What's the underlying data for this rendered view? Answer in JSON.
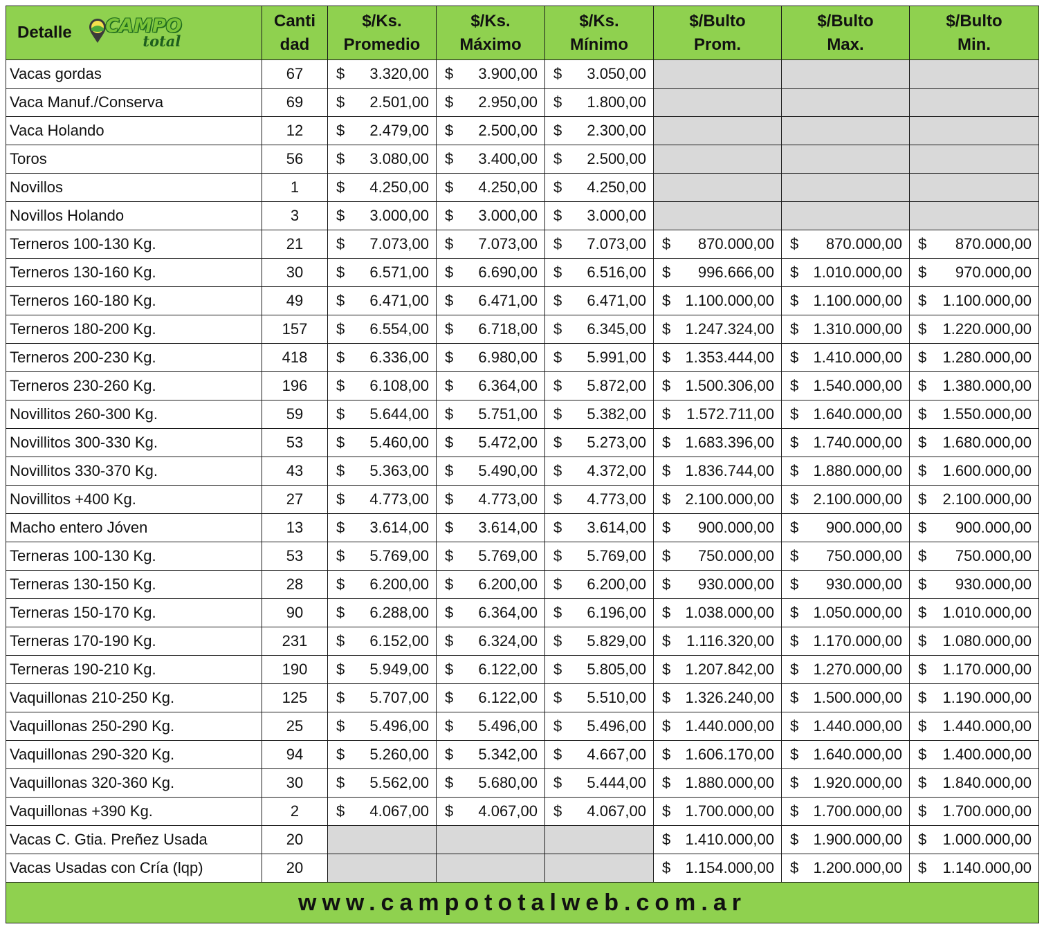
{
  "header": {
    "detalle": "Detalle",
    "logo_text_1": "CAMPO",
    "logo_text_2": "total",
    "logo_icon": "map-pin-icon",
    "cols": [
      [
        "Canti",
        "dad"
      ],
      [
        "$/Ks.",
        "Promedio"
      ],
      [
        "$/Ks.",
        "Máximo"
      ],
      [
        "$/Ks.",
        "Mínimo"
      ],
      [
        "$/Bulto",
        "Prom."
      ],
      [
        "$/Bulto",
        "Max."
      ],
      [
        "$/Bulto",
        "Min."
      ]
    ]
  },
  "currency": "$",
  "colors": {
    "header_green": "#8fd14f",
    "empty_gray": "#d9d9d9"
  },
  "rows": [
    [
      "Vacas gordas",
      "67",
      "3.320,00",
      "3.900,00",
      "3.050,00",
      "",
      "",
      ""
    ],
    [
      "Vaca Manuf./Conserva",
      "69",
      "2.501,00",
      "2.950,00",
      "1.800,00",
      "",
      "",
      ""
    ],
    [
      "Vaca Holando",
      "12",
      "2.479,00",
      "2.500,00",
      "2.300,00",
      "",
      "",
      ""
    ],
    [
      "Toros",
      "56",
      "3.080,00",
      "3.400,00",
      "2.500,00",
      "",
      "",
      ""
    ],
    [
      "Novillos",
      "1",
      "4.250,00",
      "4.250,00",
      "4.250,00",
      "",
      "",
      ""
    ],
    [
      "Novillos Holando",
      "3",
      "3.000,00",
      "3.000,00",
      "3.000,00",
      "",
      "",
      ""
    ],
    [
      "Terneros 100-130 Kg.",
      "21",
      "7.073,00",
      "7.073,00",
      "7.073,00",
      "870.000,00",
      "870.000,00",
      "870.000,00"
    ],
    [
      "Terneros 130-160 Kg.",
      "30",
      "6.571,00",
      "6.690,00",
      "6.516,00",
      "996.666,00",
      "1.010.000,00",
      "970.000,00"
    ],
    [
      "Terneros 160-180 Kg.",
      "49",
      "6.471,00",
      "6.471,00",
      "6.471,00",
      "1.100.000,00",
      "1.100.000,00",
      "1.100.000,00"
    ],
    [
      "Terneros 180-200 Kg.",
      "157",
      "6.554,00",
      "6.718,00",
      "6.345,00",
      "1.247.324,00",
      "1.310.000,00",
      "1.220.000,00"
    ],
    [
      "Terneros 200-230 Kg.",
      "418",
      "6.336,00",
      "6.980,00",
      "5.991,00",
      "1.353.444,00",
      "1.410.000,00",
      "1.280.000,00"
    ],
    [
      "Terneros 230-260 Kg.",
      "196",
      "6.108,00",
      "6.364,00",
      "5.872,00",
      "1.500.306,00",
      "1.540.000,00",
      "1.380.000,00"
    ],
    [
      "Novillitos 260-300 Kg.",
      "59",
      "5.644,00",
      "5.751,00",
      "5.382,00",
      "1.572.711,00",
      "1.640.000,00",
      "1.550.000,00"
    ],
    [
      "Novillitos 300-330 Kg.",
      "53",
      "5.460,00",
      "5.472,00",
      "5.273,00",
      "1.683.396,00",
      "1.740.000,00",
      "1.680.000,00"
    ],
    [
      "Novillitos 330-370 Kg.",
      "43",
      "5.363,00",
      "5.490,00",
      "4.372,00",
      "1.836.744,00",
      "1.880.000,00",
      "1.600.000,00"
    ],
    [
      "Novillitos +400 Kg.",
      "27",
      "4.773,00",
      "4.773,00",
      "4.773,00",
      "2.100.000,00",
      "2.100.000,00",
      "2.100.000,00"
    ],
    [
      "Macho entero Jóven",
      "13",
      "3.614,00",
      "3.614,00",
      "3.614,00",
      "900.000,00",
      "900.000,00",
      "900.000,00"
    ],
    [
      "Terneras 100-130 Kg.",
      "53",
      "5.769,00",
      "5.769,00",
      "5.769,00",
      "750.000,00",
      "750.000,00",
      "750.000,00"
    ],
    [
      "Terneras 130-150 Kg.",
      "28",
      "6.200,00",
      "6.200,00",
      "6.200,00",
      "930.000,00",
      "930.000,00",
      "930.000,00"
    ],
    [
      "Terneras 150-170 Kg.",
      "90",
      "6.288,00",
      "6.364,00",
      "6.196,00",
      "1.038.000,00",
      "1.050.000,00",
      "1.010.000,00"
    ],
    [
      "Terneras 170-190 Kg.",
      "231",
      "6.152,00",
      "6.324,00",
      "5.829,00",
      "1.116.320,00",
      "1.170.000,00",
      "1.080.000,00"
    ],
    [
      "Terneras 190-210 Kg.",
      "190",
      "5.949,00",
      "6.122,00",
      "5.805,00",
      "1.207.842,00",
      "1.270.000,00",
      "1.170.000,00"
    ],
    [
      "Vaquillonas 210-250 Kg.",
      "125",
      "5.707,00",
      "6.122,00",
      "5.510,00",
      "1.326.240,00",
      "1.500.000,00",
      "1.190.000,00"
    ],
    [
      "Vaquillonas 250-290 Kg.",
      "25",
      "5.496,00",
      "5.496,00",
      "5.496,00",
      "1.440.000,00",
      "1.440.000,00",
      "1.440.000,00"
    ],
    [
      "Vaquillonas 290-320 Kg.",
      "94",
      "5.260,00",
      "5.342,00",
      "4.667,00",
      "1.606.170,00",
      "1.640.000,00",
      "1.400.000,00"
    ],
    [
      "Vaquillonas 320-360 Kg.",
      "30",
      "5.562,00",
      "5.680,00",
      "5.444,00",
      "1.880.000,00",
      "1.920.000,00",
      "1.840.000,00"
    ],
    [
      "Vaquillonas +390 Kg.",
      "2",
      "4.067,00",
      "4.067,00",
      "4.067,00",
      "1.700.000,00",
      "1.700.000,00",
      "1.700.000,00"
    ],
    [
      "Vacas C. Gtia. Preñez Usada",
      "20",
      "",
      "",
      "",
      "1.410.000,00",
      "1.900.000,00",
      "1.000.000,00"
    ],
    [
      "Vacas Usadas con Cría (lqp)",
      "20",
      "",
      "",
      "",
      "1.154.000,00",
      "1.200.000,00",
      "1.140.000,00"
    ]
  ],
  "footer": {
    "url": "www.campototalweb.com.ar"
  }
}
